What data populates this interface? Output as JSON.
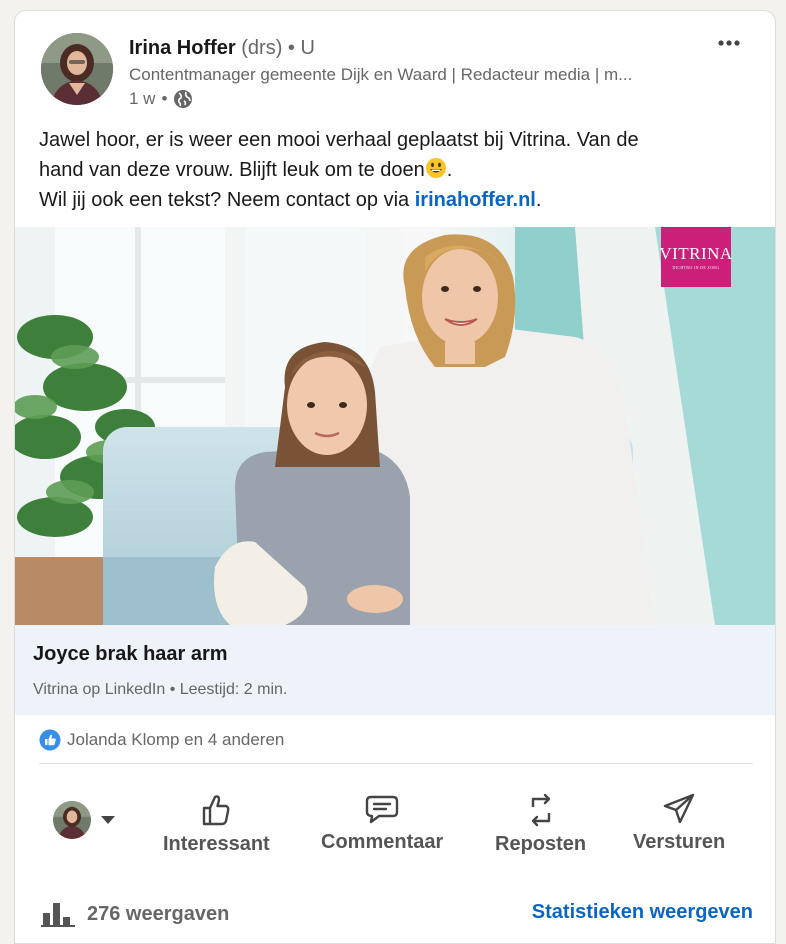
{
  "post": {
    "author": {
      "name": "Irina Hoffer",
      "degree": "(drs)",
      "connection": "U",
      "headline": "Contentmanager gemeente Dijk en Waard | Redacteur media | m...",
      "time": "1 w",
      "visibility_icon": "globe-icon"
    },
    "more_icon": "more-icon",
    "text": {
      "line1": "Jawel hoor, er is weer een mooi verhaal geplaatst bij Vitrina. Van de",
      "line2": "hand van deze vrouw. Blijft leuk om te doen",
      "line2_end": ".",
      "line3_prefix": "Wil jij ook een tekst? Neem contact op via ",
      "link": "irinahoffer.nl",
      "line3_suffix": "."
    },
    "image": {
      "logo_text": "VITRINA",
      "logo_subtext": "DICHTBIJ IN DE ZORG"
    },
    "article": {
      "title": "Joyce brak haar arm",
      "source": "Vitrina op LinkedIn • Leestijd: 2 min."
    },
    "reactions": {
      "icon": "like-reaction-icon",
      "text": "Jolanda Klomp en 4 anderen"
    },
    "actions": [
      {
        "label": "Interessant",
        "icon": "thumbs-up-icon"
      },
      {
        "label": "Commentaar",
        "icon": "comment-icon"
      },
      {
        "label": "Reposten",
        "icon": "repost-icon"
      },
      {
        "label": "Versturen",
        "icon": "send-icon"
      }
    ],
    "views": {
      "icon": "bar-chart-icon",
      "text": "276 weergaven"
    },
    "stats_link": "Statistieken weergeven"
  },
  "colors": {
    "link": "#0a66c2",
    "article_bg": "#edf3f8",
    "logo_bg": "#cc1f7a"
  }
}
